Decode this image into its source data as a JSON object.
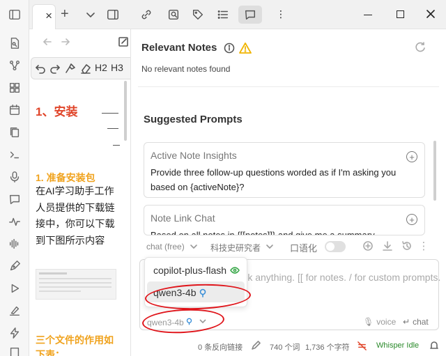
{
  "tab_bar": {
    "tab_close": "×",
    "new_tab": "+",
    "tabs_dropdown": "⌄"
  },
  "editor": {
    "toolbar": {
      "h2": "H2",
      "h3": "H3"
    },
    "heading_install": "1、安装",
    "heading_prepare": "1. 准备安装包",
    "paragraph": "在AI学习助手工作人员提供的下载链接中，你可以下载到下图所示内容",
    "heading_files": "三个文件的作用如下表："
  },
  "copilot": {
    "relevant_notes": {
      "title": "Relevant Notes",
      "empty_text": "No relevant notes found",
      "warning_color": "#f0b400"
    },
    "suggested_prompts": {
      "title": "Suggested Prompts",
      "cards": [
        {
          "title": "Active Note Insights",
          "body": "Provide three follow-up questions worded as if I'm asking you based on {activeNote}?"
        },
        {
          "title": "Note Link Chat",
          "body": "Based on all notes in {[[notes]]} and give me a summary"
        }
      ]
    },
    "controls": {
      "mode": "chat (free)",
      "persona": "科技史研究者",
      "colloquial": "口语化"
    },
    "input": {
      "placeholder": "Ask anything. [[ for notes. / for custom prompts."
    },
    "model_dropdown": {
      "options": [
        "copilot-plus-flash",
        "qwen3-4b"
      ],
      "selected": "qwen3-4b"
    },
    "current_model": "qwen3-4b",
    "voice_label": "voice",
    "chat_label": "chat",
    "annotation_color": "#e0151b"
  },
  "status_bar": {
    "backlinks": "0 条反向链接",
    "words": "740 个词",
    "chars": "1,736 个字符",
    "whisper": "Whisper Idle",
    "whisper_color": "#2a8a2a"
  }
}
